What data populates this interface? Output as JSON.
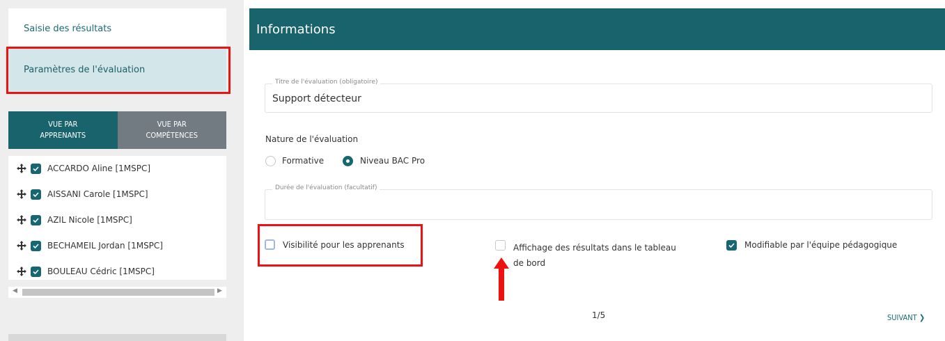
{
  "sidebar": {
    "menu": [
      {
        "label": "Saisie des résultats"
      },
      {
        "label": "Paramètres de l'évaluation"
      }
    ],
    "tabs": [
      {
        "line1": "VUE PAR",
        "line2": "APPRENANTS"
      },
      {
        "line1": "VUE PAR",
        "line2": "COMPÉTENCES"
      }
    ],
    "students": [
      {
        "name": "ACCARDO Aline [1MSPC]"
      },
      {
        "name": "AISSANI Carole [1MSPC]"
      },
      {
        "name": "AZIL Nicole [1MSPC]"
      },
      {
        "name": "BECHAMEIL Jordan [1MSPC]"
      },
      {
        "name": "BOULEAU Cédric [1MSPC]"
      }
    ]
  },
  "panel": {
    "title": "Informations",
    "title_field": {
      "label": "Titre de l'évaluation (obligatoire)",
      "value": "Support détecteur"
    },
    "nature": {
      "label": "Nature de l'évaluation",
      "options": [
        {
          "label": "Formative",
          "selected": false
        },
        {
          "label": "Niveau BAC Pro",
          "selected": true
        }
      ]
    },
    "duration_field": {
      "label": "Durée de l'évaluation (facultatif)",
      "value": ""
    },
    "checkboxes": {
      "visibility": {
        "label": "Visibilité pour les apprenants",
        "checked": false
      },
      "dashboard": {
        "line1": "Affichage des résultats dans le tableau",
        "line2": "de bord",
        "checked": false
      },
      "editable": {
        "label": "Modifiable par l'équipe pédagogique",
        "checked": true
      }
    },
    "pager": "1/5",
    "next_label": "SUIVANT"
  },
  "colors": {
    "teal": "#19646c",
    "highlight": "#ee1111",
    "tab_inactive": "#727b82"
  }
}
